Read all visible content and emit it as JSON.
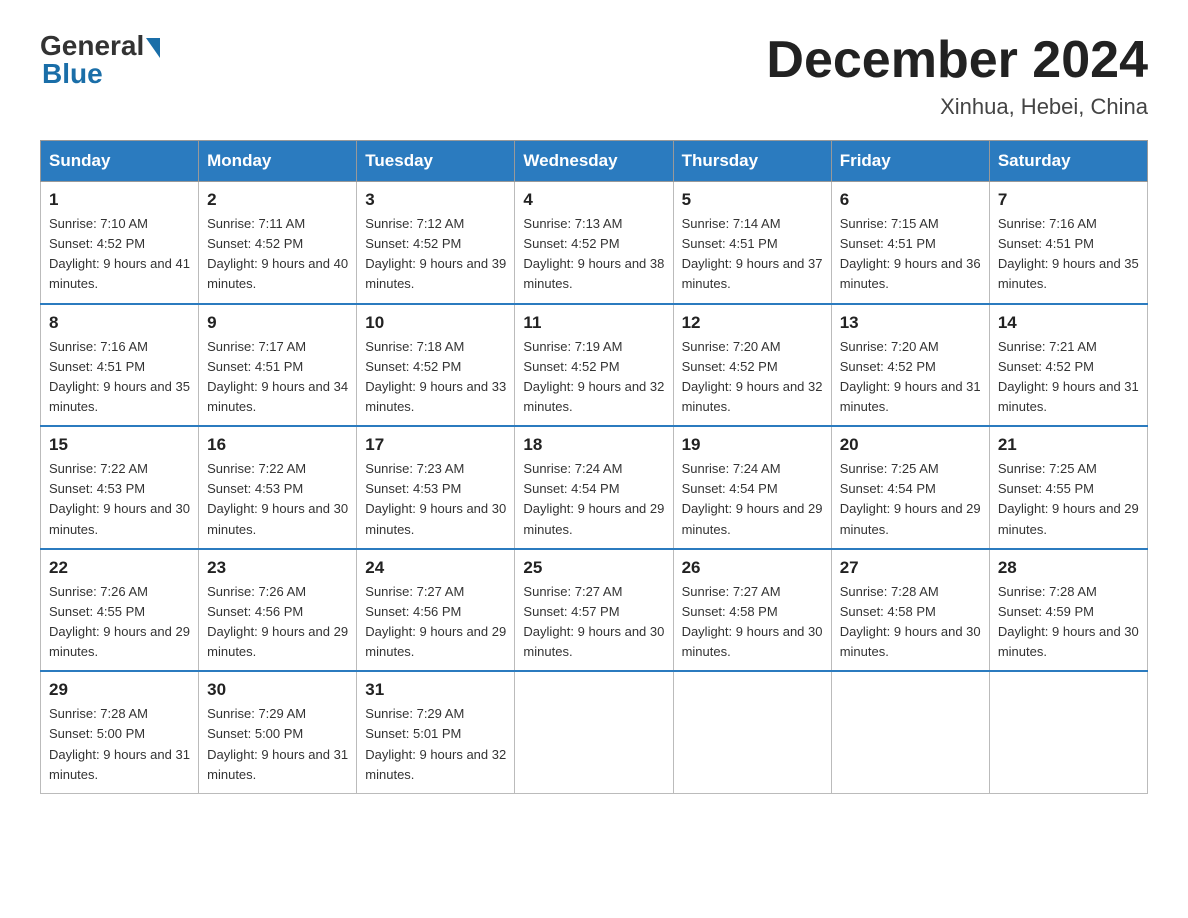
{
  "header": {
    "logo_general": "General",
    "logo_blue": "Blue",
    "month_title": "December 2024",
    "location": "Xinhua, Hebei, China"
  },
  "days_of_week": [
    "Sunday",
    "Monday",
    "Tuesday",
    "Wednesday",
    "Thursday",
    "Friday",
    "Saturday"
  ],
  "weeks": [
    [
      {
        "day": "1",
        "sunrise": "Sunrise: 7:10 AM",
        "sunset": "Sunset: 4:52 PM",
        "daylight": "Daylight: 9 hours and 41 minutes."
      },
      {
        "day": "2",
        "sunrise": "Sunrise: 7:11 AM",
        "sunset": "Sunset: 4:52 PM",
        "daylight": "Daylight: 9 hours and 40 minutes."
      },
      {
        "day": "3",
        "sunrise": "Sunrise: 7:12 AM",
        "sunset": "Sunset: 4:52 PM",
        "daylight": "Daylight: 9 hours and 39 minutes."
      },
      {
        "day": "4",
        "sunrise": "Sunrise: 7:13 AM",
        "sunset": "Sunset: 4:52 PM",
        "daylight": "Daylight: 9 hours and 38 minutes."
      },
      {
        "day": "5",
        "sunrise": "Sunrise: 7:14 AM",
        "sunset": "Sunset: 4:51 PM",
        "daylight": "Daylight: 9 hours and 37 minutes."
      },
      {
        "day": "6",
        "sunrise": "Sunrise: 7:15 AM",
        "sunset": "Sunset: 4:51 PM",
        "daylight": "Daylight: 9 hours and 36 minutes."
      },
      {
        "day": "7",
        "sunrise": "Sunrise: 7:16 AM",
        "sunset": "Sunset: 4:51 PM",
        "daylight": "Daylight: 9 hours and 35 minutes."
      }
    ],
    [
      {
        "day": "8",
        "sunrise": "Sunrise: 7:16 AM",
        "sunset": "Sunset: 4:51 PM",
        "daylight": "Daylight: 9 hours and 35 minutes."
      },
      {
        "day": "9",
        "sunrise": "Sunrise: 7:17 AM",
        "sunset": "Sunset: 4:51 PM",
        "daylight": "Daylight: 9 hours and 34 minutes."
      },
      {
        "day": "10",
        "sunrise": "Sunrise: 7:18 AM",
        "sunset": "Sunset: 4:52 PM",
        "daylight": "Daylight: 9 hours and 33 minutes."
      },
      {
        "day": "11",
        "sunrise": "Sunrise: 7:19 AM",
        "sunset": "Sunset: 4:52 PM",
        "daylight": "Daylight: 9 hours and 32 minutes."
      },
      {
        "day": "12",
        "sunrise": "Sunrise: 7:20 AM",
        "sunset": "Sunset: 4:52 PM",
        "daylight": "Daylight: 9 hours and 32 minutes."
      },
      {
        "day": "13",
        "sunrise": "Sunrise: 7:20 AM",
        "sunset": "Sunset: 4:52 PM",
        "daylight": "Daylight: 9 hours and 31 minutes."
      },
      {
        "day": "14",
        "sunrise": "Sunrise: 7:21 AM",
        "sunset": "Sunset: 4:52 PM",
        "daylight": "Daylight: 9 hours and 31 minutes."
      }
    ],
    [
      {
        "day": "15",
        "sunrise": "Sunrise: 7:22 AM",
        "sunset": "Sunset: 4:53 PM",
        "daylight": "Daylight: 9 hours and 30 minutes."
      },
      {
        "day": "16",
        "sunrise": "Sunrise: 7:22 AM",
        "sunset": "Sunset: 4:53 PM",
        "daylight": "Daylight: 9 hours and 30 minutes."
      },
      {
        "day": "17",
        "sunrise": "Sunrise: 7:23 AM",
        "sunset": "Sunset: 4:53 PM",
        "daylight": "Daylight: 9 hours and 30 minutes."
      },
      {
        "day": "18",
        "sunrise": "Sunrise: 7:24 AM",
        "sunset": "Sunset: 4:54 PM",
        "daylight": "Daylight: 9 hours and 29 minutes."
      },
      {
        "day": "19",
        "sunrise": "Sunrise: 7:24 AM",
        "sunset": "Sunset: 4:54 PM",
        "daylight": "Daylight: 9 hours and 29 minutes."
      },
      {
        "day": "20",
        "sunrise": "Sunrise: 7:25 AM",
        "sunset": "Sunset: 4:54 PM",
        "daylight": "Daylight: 9 hours and 29 minutes."
      },
      {
        "day": "21",
        "sunrise": "Sunrise: 7:25 AM",
        "sunset": "Sunset: 4:55 PM",
        "daylight": "Daylight: 9 hours and 29 minutes."
      }
    ],
    [
      {
        "day": "22",
        "sunrise": "Sunrise: 7:26 AM",
        "sunset": "Sunset: 4:55 PM",
        "daylight": "Daylight: 9 hours and 29 minutes."
      },
      {
        "day": "23",
        "sunrise": "Sunrise: 7:26 AM",
        "sunset": "Sunset: 4:56 PM",
        "daylight": "Daylight: 9 hours and 29 minutes."
      },
      {
        "day": "24",
        "sunrise": "Sunrise: 7:27 AM",
        "sunset": "Sunset: 4:56 PM",
        "daylight": "Daylight: 9 hours and 29 minutes."
      },
      {
        "day": "25",
        "sunrise": "Sunrise: 7:27 AM",
        "sunset": "Sunset: 4:57 PM",
        "daylight": "Daylight: 9 hours and 30 minutes."
      },
      {
        "day": "26",
        "sunrise": "Sunrise: 7:27 AM",
        "sunset": "Sunset: 4:58 PM",
        "daylight": "Daylight: 9 hours and 30 minutes."
      },
      {
        "day": "27",
        "sunrise": "Sunrise: 7:28 AM",
        "sunset": "Sunset: 4:58 PM",
        "daylight": "Daylight: 9 hours and 30 minutes."
      },
      {
        "day": "28",
        "sunrise": "Sunrise: 7:28 AM",
        "sunset": "Sunset: 4:59 PM",
        "daylight": "Daylight: 9 hours and 30 minutes."
      }
    ],
    [
      {
        "day": "29",
        "sunrise": "Sunrise: 7:28 AM",
        "sunset": "Sunset: 5:00 PM",
        "daylight": "Daylight: 9 hours and 31 minutes."
      },
      {
        "day": "30",
        "sunrise": "Sunrise: 7:29 AM",
        "sunset": "Sunset: 5:00 PM",
        "daylight": "Daylight: 9 hours and 31 minutes."
      },
      {
        "day": "31",
        "sunrise": "Sunrise: 7:29 AM",
        "sunset": "Sunset: 5:01 PM",
        "daylight": "Daylight: 9 hours and 32 minutes."
      },
      null,
      null,
      null,
      null
    ]
  ]
}
